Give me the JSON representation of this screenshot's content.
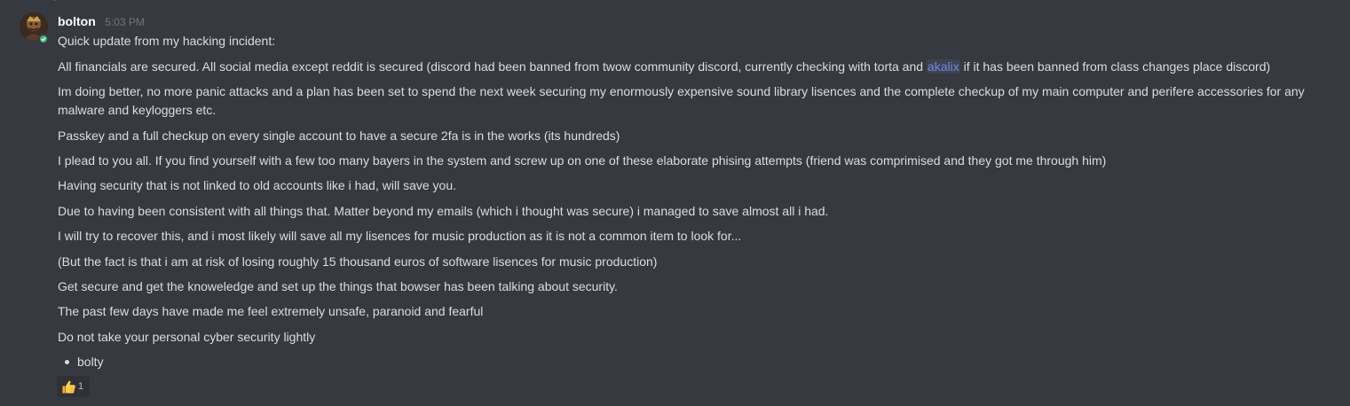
{
  "message": {
    "author": "bolton",
    "timestamp": "5:03 PM",
    "line1": "Quick update from my hacking incident:",
    "line2_a": "All financials are secured. All social media except reddit is secured (discord had been banned from twow community discord, currently checking with torta and ",
    "line2_mention": "akalix",
    "line2_b": " if it has been banned from class changes place discord)",
    "line3": "Im doing better, no more panic attacks and a plan has been set to spend the next week securing my enormously expensive sound library lisences and the complete checkup of my main computer and perifere accessories for any malware and keyloggers etc.",
    "line4": "Passkey and a full checkup on every single account to have a secure 2fa is in the works (its hundreds)",
    "line5": "I plead to you all. If you find yourself with a few too many bayers in the system and screw up on one of these elaborate phising attempts (friend was comprimised and they got me through him)",
    "line6": "Having security that is not linked to old accounts like i had, will save you.",
    "line7": "Due to having been consistent with all things that. Matter beyond my emails (which i thought was secure) i managed to save almost all i had.",
    "line8": "I will try to recover this, and i most likely will save all my lisences for music production as it is not a common item to look for...",
    "line9": "(But the fact is that i am at risk of losing roughly 15 thousand euros of software lisences for music production)",
    "line10": "Get secure and get the knoweledge and set up the things that bowser has been talking about security.",
    "line11": "The past few days have made me feel extremely unsafe, paranoid and fearful",
    "line12": "Do not take your personal cyber security lightly",
    "bullet": "bolty"
  },
  "reaction": {
    "emoji": "thumbs-up-icon",
    "count": "1"
  },
  "colors": {
    "background": "#36393f",
    "text": "#dcddde",
    "mention": "#7289da",
    "online": "#43b581",
    "timestamp": "#72767d"
  }
}
